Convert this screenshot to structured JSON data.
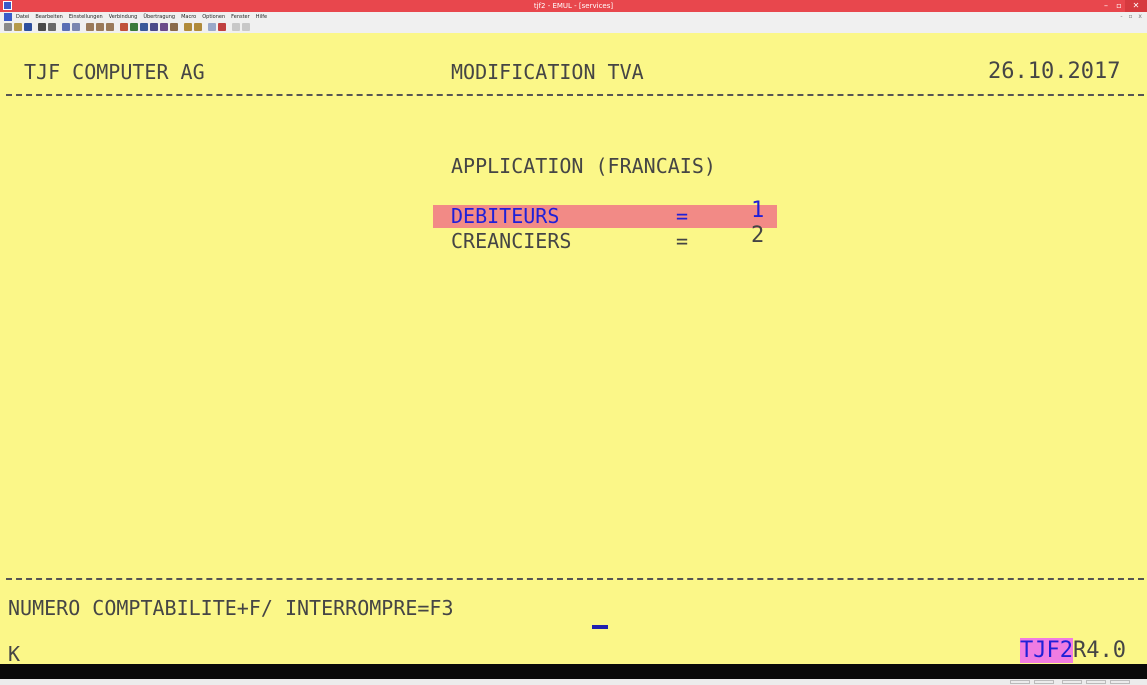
{
  "window": {
    "title": "tjf2 - EMUL - [services]",
    "controls": {
      "minimize": "–",
      "maximize": "▫",
      "close": "✕"
    }
  },
  "menubar": {
    "items": [
      "Datei",
      "Bearbeiten",
      "Einstellungen",
      "Verbindung",
      "Übertragung",
      "Macro",
      "Optionen",
      "Fenster",
      "Hilfe"
    ],
    "mdi_controls": "- ▫ x"
  },
  "terminal": {
    "company": "TJF COMPUTER AG",
    "screen_title": "MODIFICATION TVA",
    "date": "26.10.2017",
    "heading": "APPLICATION (FRANCAIS)",
    "options": [
      {
        "label": "DEBITEURS",
        "eq": "=",
        "value": "1"
      },
      {
        "label": "CREANCIERS",
        "eq": "=",
        "value": "2"
      }
    ],
    "prompt": "NUMERO COMPTABILITE+F/ INTERROMPRE=F3",
    "status_left": "K",
    "system_id": "TJF2",
    "release": "R4.0"
  },
  "colors": {
    "screen_bg": "#fbf788",
    "selection": "#f28a86",
    "highlight_text": "#2020d8",
    "system_badge": "#f07ce2",
    "titlebar": "#e8474d"
  }
}
